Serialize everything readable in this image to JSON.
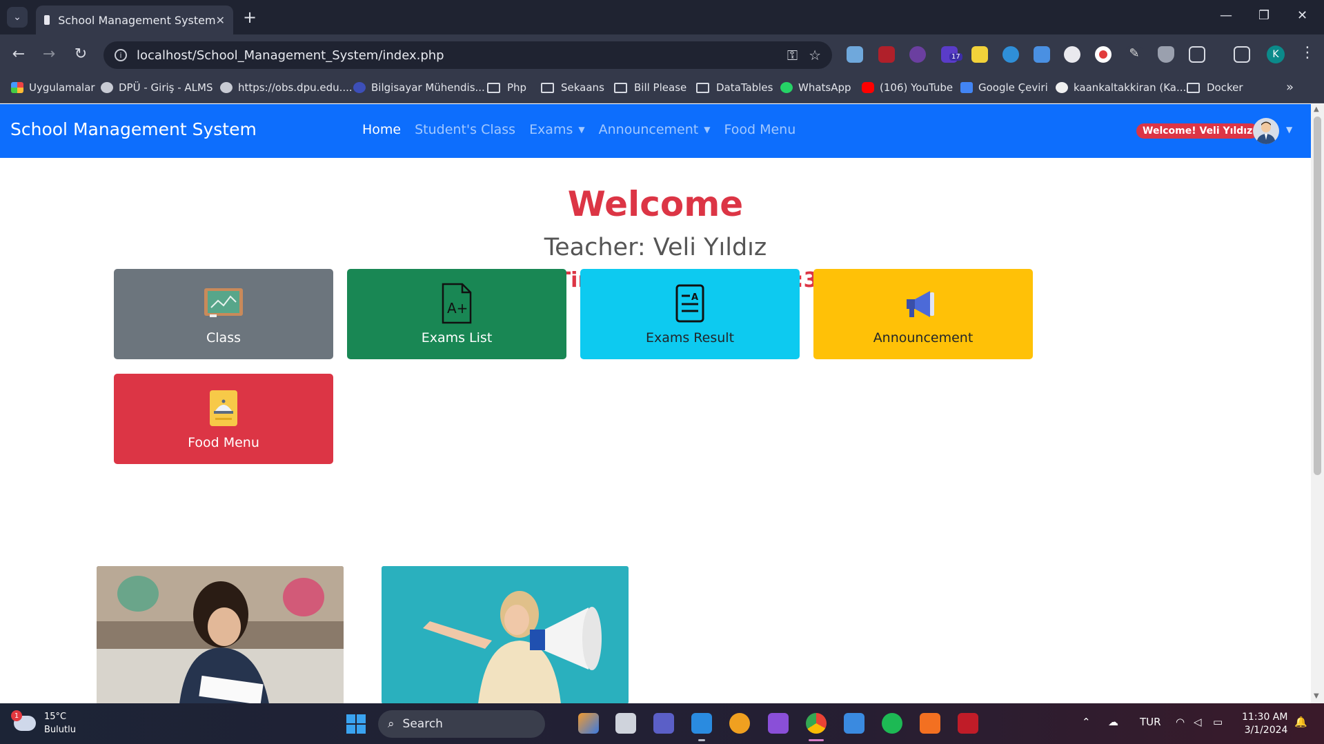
{
  "browser": {
    "tab_title": "School Management System",
    "url": "localhost/School_Management_System/index.php",
    "profile_initial": "K",
    "extension_badge": "17",
    "bookmarks": [
      {
        "label": "Uygulamalar",
        "type": "apps"
      },
      {
        "label": "DPÜ - Giriş - ALMS",
        "type": "site"
      },
      {
        "label": "https://obs.dpu.edu....",
        "type": "site"
      },
      {
        "label": "Bilgisayar Mühendis...",
        "type": "site"
      },
      {
        "label": "Php",
        "type": "folder"
      },
      {
        "label": "Sekaans",
        "type": "folder"
      },
      {
        "label": "Bill Please",
        "type": "folder"
      },
      {
        "label": "DataTables",
        "type": "folder"
      },
      {
        "label": "WhatsApp",
        "type": "site"
      },
      {
        "label": "(106) YouTube",
        "type": "site"
      },
      {
        "label": "Google Çeviri",
        "type": "site"
      },
      {
        "label": "kaankaltakkiran (Ka...",
        "type": "site"
      },
      {
        "label": "Docker",
        "type": "folder"
      }
    ]
  },
  "navbar": {
    "brand": "School Management System",
    "links": [
      {
        "label": "Home",
        "active": true,
        "dropdown": false
      },
      {
        "label": "Student's Class",
        "active": false,
        "dropdown": false
      },
      {
        "label": "Exams",
        "active": false,
        "dropdown": true
      },
      {
        "label": "Announcement",
        "active": false,
        "dropdown": true
      },
      {
        "label": "Food Menu",
        "active": false,
        "dropdown": false
      }
    ],
    "welcome_badge": "Welcome! Veli Yıldız"
  },
  "hero": {
    "title": "Welcome",
    "teacher": "Teacher: Veli Yıldız",
    "datetime": "Date And Time: 01/03/2024 11:30:37"
  },
  "cards": [
    {
      "label": "Class",
      "color": "#6c757d",
      "icon": "chalkboard-icon"
    },
    {
      "label": "Exams List",
      "color": "#198754",
      "icon": "exam-grade-icon"
    },
    {
      "label": "Exams Result",
      "color": "#0dcaf0",
      "icon": "document-result-icon"
    },
    {
      "label": "Announcement",
      "color": "#ffc107",
      "icon": "megaphone-icon"
    },
    {
      "label": "Food Menu",
      "color": "#dc3545",
      "icon": "food-cloche-icon"
    }
  ],
  "taskbar": {
    "weather_temp": "15°C",
    "weather_desc": "Bulutlu",
    "weather_badge": "1",
    "search_label": "Search",
    "language": "TUR",
    "time": "11:30 AM",
    "date": "3/1/2024"
  },
  "colors": {
    "navbar": "#0d6efd",
    "accent_red": "#dc3545"
  }
}
